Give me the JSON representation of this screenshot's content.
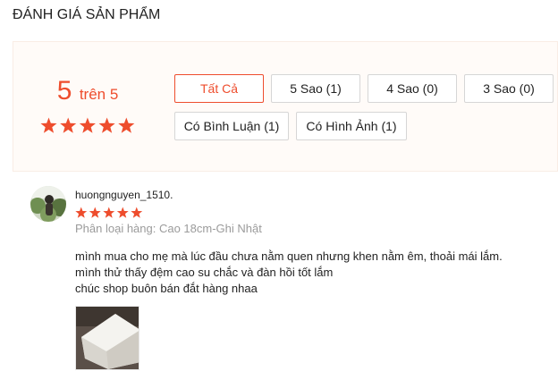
{
  "section": {
    "title": "ĐÁNH GIÁ SẢN PHẨM"
  },
  "overview": {
    "score": "5",
    "out_of": "trên 5",
    "rating": 5,
    "max_rating": 5
  },
  "filters": [
    {
      "label": "Tất Cả",
      "active": true
    },
    {
      "label": "5 Sao (1)",
      "active": false
    },
    {
      "label": "4 Sao (0)",
      "active": false
    },
    {
      "label": "3 Sao (0)",
      "active": false
    },
    {
      "label": "Có Bình Luận (1)",
      "active": false
    },
    {
      "label": "Có Hình Ảnh (1)",
      "active": false
    }
  ],
  "review": {
    "username": "huongnguyen_1510.",
    "rating": 5,
    "variation": "Phân loại hàng: Cao 18cm-Ghi Nhật",
    "comment_lines": [
      "mình mua cho mẹ mà lúc đầu chưa nằm quen nhưng khen nằm êm, thoải mái lắm.",
      "mình thử thấy đệm cao su chắc và đàn hồi tốt lắm",
      "chúc shop buôn bán đắt hàng nhaa"
    ]
  },
  "colors": {
    "accent": "#ee4d2d",
    "star": "#ee4d2d",
    "muted": "#9b9b9b"
  },
  "icons": {
    "star": "star-icon",
    "avatar": "avatar-photo",
    "product_photo": "review-photo"
  }
}
